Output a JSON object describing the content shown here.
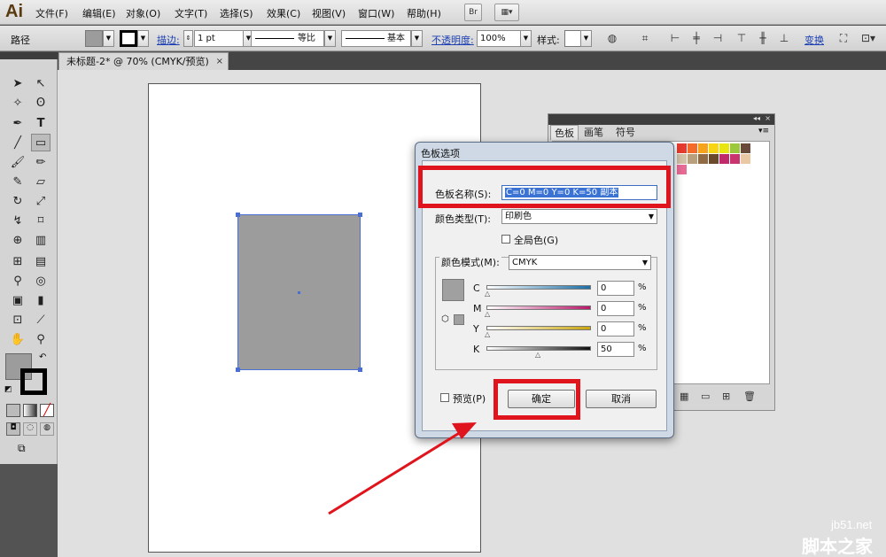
{
  "app": {
    "logo": "Ai"
  },
  "menu": [
    "文件(F)",
    "编辑(E)",
    "对象(O)",
    "文字(T)",
    "选择(S)",
    "效果(C)",
    "视图(V)",
    "窗口(W)",
    "帮助(H)"
  ],
  "menu_buttons": {
    "bridge": "Br"
  },
  "control_bar": {
    "selection_label": "路径",
    "stroke_link": "描边:",
    "stroke_weight": "1 pt",
    "profile_1": "等比",
    "profile_2": "基本",
    "opacity_link": "不透明度:",
    "opacity_value": "100%",
    "style_label": "样式:",
    "transform_link": "变换",
    "fill_color": "#9c9c9c",
    "stroke_color": "#000000"
  },
  "document": {
    "tab_title": "未标题-2* @ 70% (CMYK/预览)",
    "close": "×"
  },
  "swatches_panel": {
    "tabs": [
      "色板",
      "画笔",
      "符号"
    ],
    "colors": [
      "#e63b2e",
      "#f26b2a",
      "#f7a21b",
      "#f8d514",
      "#e8e612",
      "#9bc83c",
      "#6a4a3a",
      "#d2c2a8",
      "#b8a07c",
      "#8f6a45",
      "#6b4a2c",
      "#c02a6a",
      "#c9356f",
      "#e8c9a3",
      "#e86b96"
    ],
    "footer_icons": [
      "library-icon",
      "folder-icon",
      "new-swatch-icon",
      "trash-icon"
    ]
  },
  "dialog": {
    "title": "色板选项",
    "swatch_name_label": "色板名称(S):",
    "swatch_name_value": "C=0 M=0 Y=0 K=50  副本",
    "color_type_label": "颜色类型(T):",
    "color_type_value": "印刷色",
    "global_label": "全局色(G)",
    "color_mode_label": "颜色模式(M):",
    "color_mode_value": "CMYK",
    "channels": [
      {
        "label": "C",
        "value": "0",
        "unit": "%",
        "level": 0
      },
      {
        "label": "M",
        "value": "0",
        "unit": "%",
        "level": 0
      },
      {
        "label": "Y",
        "value": "0",
        "unit": "%",
        "level": 0
      },
      {
        "label": "K",
        "value": "50",
        "unit": "%",
        "level": 50
      }
    ],
    "preview_label": "预览(P)",
    "ok_label": "确定",
    "cancel_label": "取消",
    "preview_color": "#a0a0a0"
  },
  "watermark": {
    "line1": "jb51.net",
    "line2": "脚本之家"
  }
}
